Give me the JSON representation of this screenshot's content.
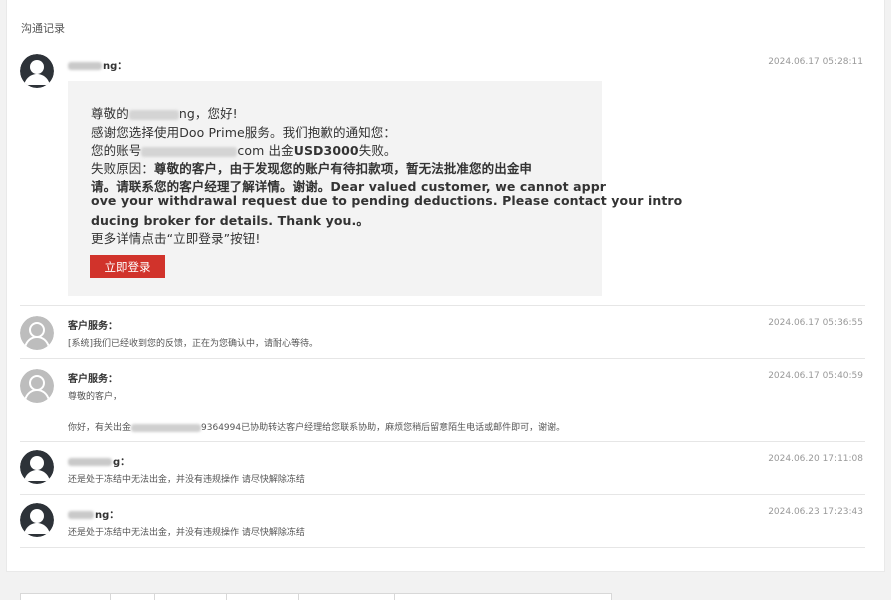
{
  "page": {
    "title": "沟通记录"
  },
  "colors": {
    "accent": "#d1332b",
    "divider": "#e6e6e6",
    "muted_text": "#999999"
  },
  "messages": [
    {
      "sender_suffix": "ng",
      "time": "2024.06.17 05:28:11",
      "avatar": "dark-user-icon",
      "email": {
        "greeting_prefix": "尊敬的",
        "greeting_suffix": "ng，您好!",
        "line2": "感谢您选择使用Doo Prime服务。我们抱歉的通知您：",
        "line3_prefix": "您的账号",
        "line3_mid": "com 出金",
        "line3_bold": "USD3000",
        "line3_suffix": "失败。",
        "reason_label": "失败原因：",
        "reason_cn_1": "尊敬的客户，由于发现您的账户有待扣款项，暂无法批准您的出金申",
        "reason_cn_2": "请。请联系您的客户经理了解详情。谢谢。Dear valued customer, we cannot appr",
        "reason_en_1": "ove your withdrawal request due to pending deductions. Please contact your intro",
        "reason_en_2": "ducing broker for details. Thank you.。",
        "more": "更多详情点击“立即登录”按钮!",
        "login_button": "立即登录"
      }
    },
    {
      "sender": "客户服务：",
      "time": "2024.06.17 05:36:55",
      "avatar": "gray-user-icon",
      "text": "[系统]我们已经收到您的反馈，正在为您确认中，请耐心等待。"
    },
    {
      "sender": "客户服务：",
      "time": "2024.06.17 05:40:59",
      "avatar": "gray-user-icon",
      "text1": "尊敬的客户，",
      "text2_prefix": "你好，有关出金",
      "text2_suffix": "9364994已协助转达客户经理给您联系协助，麻烦您稍后留意陌生电话或邮件即可，谢谢。"
    },
    {
      "sender_suffix": "g：",
      "time": "2024.06.20 17:11:08",
      "avatar": "dark-user-icon",
      "text": "还是处于冻结中无法出金，并没有违规操作 请尽快解除冻结"
    },
    {
      "sender_suffix": "ng：",
      "time": "2024.06.23 17:23:43",
      "avatar": "dark-user-icon",
      "text": "还是处于冻结中无法出金，并没有违规操作 请尽快解除冻结"
    }
  ],
  "first_sender_colon": "："
}
